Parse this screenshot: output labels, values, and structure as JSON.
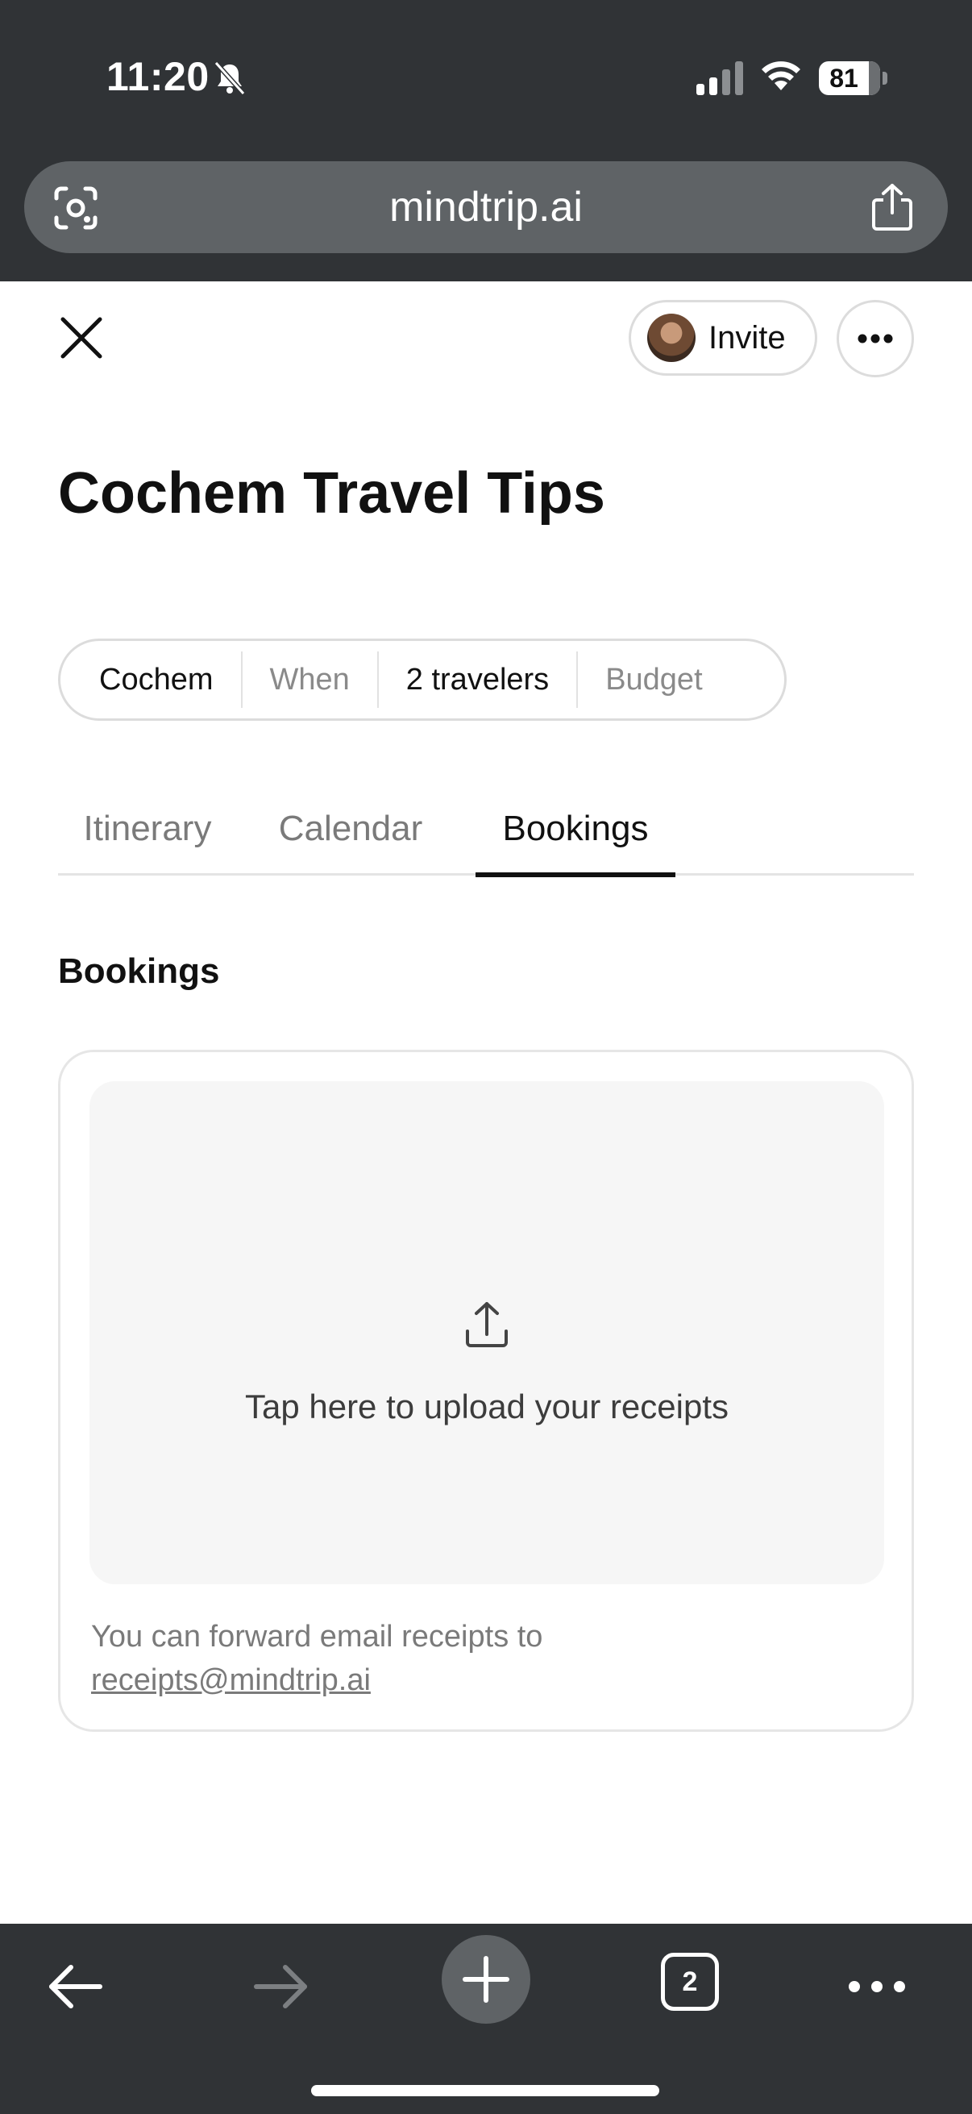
{
  "status_bar": {
    "time": "11:20",
    "battery": "81",
    "icons": [
      "bell-slash-icon",
      "signal-icon",
      "wifi-icon",
      "battery-icon"
    ]
  },
  "browser": {
    "url": "mindtrip.ai",
    "tab_count": "2",
    "icons": [
      "lens-icon",
      "share-icon",
      "back-arrow-icon",
      "forward-arrow-icon",
      "plus-icon",
      "tabs-icon",
      "more-icon"
    ]
  },
  "header": {
    "invite_label": "Invite",
    "icons": [
      "close-icon",
      "avatar",
      "more-dots-icon"
    ]
  },
  "trip": {
    "title": "Cochem Travel Tips",
    "chips": [
      {
        "label": "Cochem",
        "filled": true
      },
      {
        "label": "When",
        "filled": false
      },
      {
        "label": "2 travelers",
        "filled": true
      },
      {
        "label": "Budget",
        "filled": false
      }
    ]
  },
  "tabs": [
    {
      "label": "Itinerary",
      "active": false
    },
    {
      "label": "Calendar",
      "active": false
    },
    {
      "label": "Bookings",
      "active": true
    }
  ],
  "bookings": {
    "section_title": "Bookings",
    "upload_prompt": "Tap here to upload your receipts",
    "forward_note": "You can forward email receipts to",
    "receipt_email": "receipts@mindtrip.ai"
  },
  "colors": {
    "chrome": "#303336",
    "urlbar": "#5f6366",
    "text_primary": "#111111",
    "text_muted": "#7a7a7a",
    "dropzone": "#f6f6f6"
  }
}
